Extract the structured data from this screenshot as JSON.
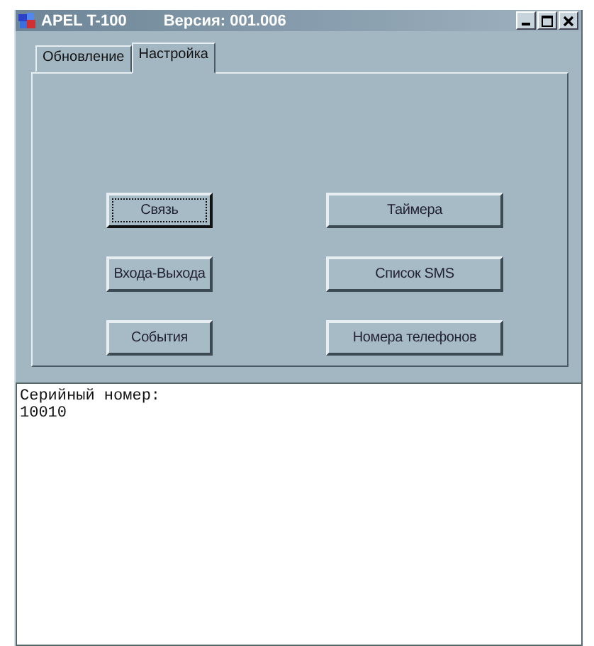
{
  "window": {
    "title": "APEL T-100",
    "version": "Версия: 001.006"
  },
  "tabs": [
    {
      "label": "Обновление",
      "selected": false
    },
    {
      "label": "Настройка",
      "selected": true
    }
  ],
  "buttons": [
    {
      "label": "Связь",
      "focused": true
    },
    {
      "label": "Таймера",
      "focused": false
    },
    {
      "label": "Входа-Выхода",
      "focused": false
    },
    {
      "label": "Список SMS",
      "focused": false
    },
    {
      "label": "События",
      "focused": false
    },
    {
      "label": "Номера телефонов",
      "focused": false
    }
  ],
  "output": {
    "lines": [
      "Серийный номер:",
      "10010"
    ]
  }
}
